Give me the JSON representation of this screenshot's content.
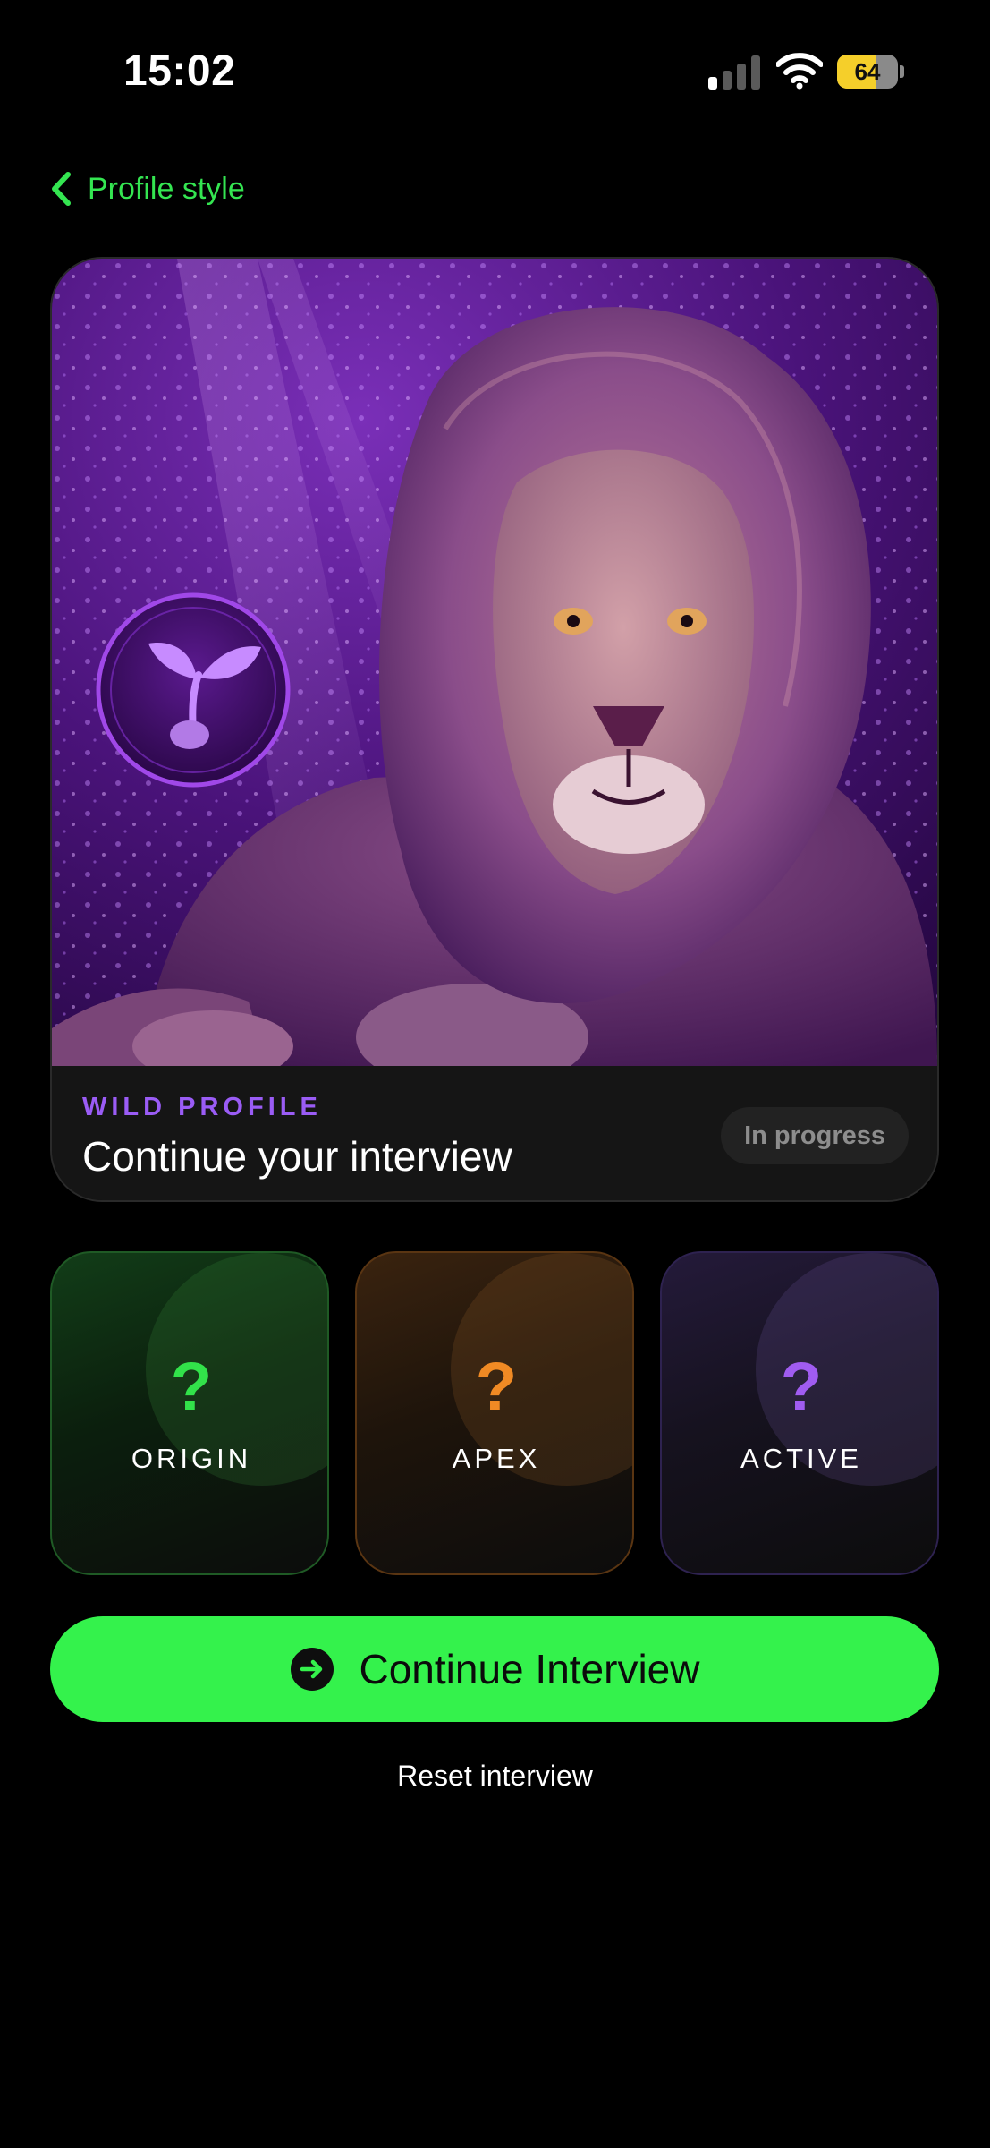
{
  "status_bar": {
    "time": "15:02",
    "battery_label": "64",
    "battery_level": 0.64,
    "signal_bars_active": 1,
    "signal_bars_total": 4
  },
  "nav": {
    "back_label": "Profile style",
    "back_icon": "chevron-left-icon"
  },
  "hero": {
    "eyebrow": "WILD PROFILE",
    "title": "Continue your interview",
    "status": "In progress",
    "image": "lion-portrait",
    "emblem_icon": "sprout-icon"
  },
  "traits": [
    {
      "label": "ORIGIN",
      "symbol": "?",
      "color": "#32e24a"
    },
    {
      "label": "APEX",
      "symbol": "?",
      "color": "#f08a24"
    },
    {
      "label": "ACTIVE",
      "symbol": "?",
      "color": "#a05cf0"
    }
  ],
  "cta": {
    "label": "Continue Interview",
    "icon": "arrow-right-circle-icon"
  },
  "reset_label": "Reset interview",
  "colors": {
    "accent_green": "#34f24c",
    "nav_green": "#34e551",
    "eyebrow_purple": "#9a5cf5",
    "background": "#000000"
  }
}
